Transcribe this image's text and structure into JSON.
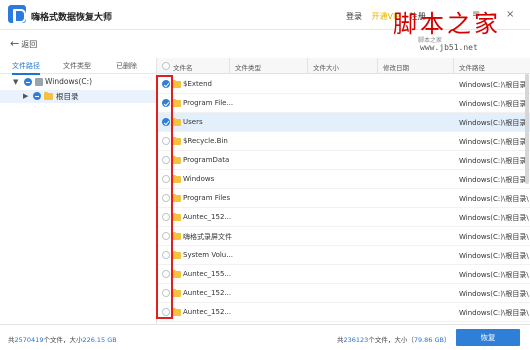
{
  "app": {
    "title": "嗨格式数据恢复大师"
  },
  "titlebar": {
    "login": "登录",
    "vip": "开通VIP",
    "register": "注册",
    "menu_icon": "≡",
    "minimize_icon": "−",
    "close_icon": "×"
  },
  "watermark": {
    "text": "脚本之家",
    "url": "www.jb51.net",
    "sub": "脚本之家"
  },
  "nav": {
    "back_label": "返回"
  },
  "tabs": [
    {
      "label": "文件路径",
      "active": true
    },
    {
      "label": "文件类型",
      "active": false
    },
    {
      "label": "已删除",
      "active": false
    }
  ],
  "tree": [
    {
      "label": "Windows(C:)",
      "type": "drive",
      "expanded": true,
      "checked": true
    },
    {
      "label": "根目录",
      "type": "folder",
      "expanded": false,
      "checked": true
    }
  ],
  "table": {
    "columns": [
      "文件名",
      "文件类型",
      "文件大小",
      "修改日期",
      "文件路径"
    ],
    "rows": [
      {
        "name": "$Extend",
        "path": "Windows(C:)\\根目录\\",
        "checked": true,
        "selected": false
      },
      {
        "name": "Program File...",
        "path": "Windows(C:)\\根目录\\",
        "checked": true,
        "selected": false
      },
      {
        "name": "Users",
        "path": "Windows(C:)\\根目录\\",
        "checked": true,
        "selected": true
      },
      {
        "name": "$Recycle.Bin",
        "path": "Windows(C:)\\根目录\\",
        "checked": false,
        "selected": false
      },
      {
        "name": "ProgramData",
        "path": "Windows(C:)\\根目录\\",
        "checked": false,
        "selected": false
      },
      {
        "name": "Windows",
        "path": "Windows(C:)\\根目录\\",
        "checked": false,
        "selected": false
      },
      {
        "name": "Program Files",
        "path": "Windows(C:)\\根目录\\",
        "checked": false,
        "selected": false
      },
      {
        "name": "Auntec_152...",
        "path": "Windows(C:)\\根目录\\",
        "checked": false,
        "selected": false
      },
      {
        "name": "嗨格式录屏文件",
        "path": "Windows(C:)\\根目录\\",
        "checked": false,
        "selected": false
      },
      {
        "name": "System Volu...",
        "path": "Windows(C:)\\根目录\\",
        "checked": false,
        "selected": false
      },
      {
        "name": "Auntec_155...",
        "path": "Windows(C:)\\根目录\\",
        "checked": false,
        "selected": false
      },
      {
        "name": "Auntec_152...",
        "path": "Windows(C:)\\根目录\\",
        "checked": false,
        "selected": false
      },
      {
        "name": "Auntec_152...",
        "path": "Windows(C:)\\根目录\\",
        "checked": false,
        "selected": false
      }
    ]
  },
  "footer": {
    "left_prefix": "共",
    "left_count": "2570419",
    "left_mid": "个文件，大小",
    "left_size": "226.15 GB",
    "right_prefix": "共",
    "right_count": "236123",
    "right_mid": "个文件，大小（",
    "right_size": "79.86 GB",
    "right_suffix": "）",
    "recover_label": "恢复"
  },
  "colors": {
    "accent": "#2f7ed8",
    "highlight_box": "#e0201d",
    "vip": "#e3b100",
    "watermark": "#d40000"
  }
}
